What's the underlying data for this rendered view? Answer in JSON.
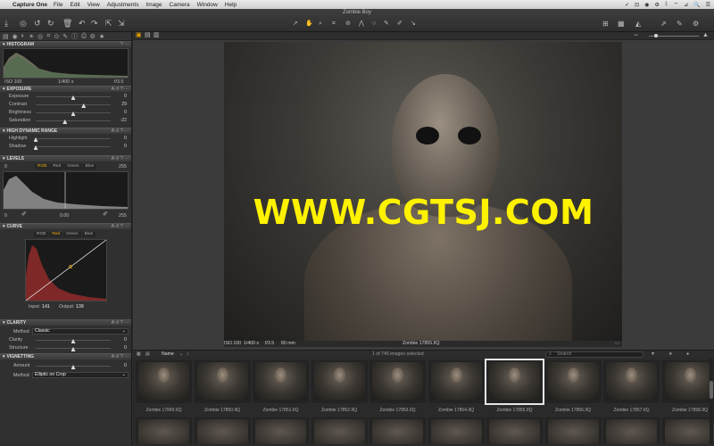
{
  "menubar": {
    "apple": "",
    "app": "Capture One",
    "items": [
      "File",
      "Edit",
      "View",
      "Adjustments",
      "Image",
      "Camera",
      "Window",
      "Help"
    ],
    "status": [
      "✓",
      "⊡",
      "◉",
      "⚙",
      "ᛒ",
      "⌔",
      "⊿",
      "🔍",
      "☰"
    ]
  },
  "window": {
    "title": "Zombie Boy"
  },
  "histogram": {
    "title": "HISTOGRAM",
    "iso": "ISO 100",
    "shutter": "1/400 s",
    "aperture": "f/3.5"
  },
  "exposure": {
    "title": "EXPOSURE",
    "sliders": [
      {
        "label": "Exposure",
        "value": "0",
        "level": 0.5
      },
      {
        "label": "Contrast",
        "value": "29",
        "level": 0.64
      },
      {
        "label": "Brightness",
        "value": "0",
        "level": 0.5
      },
      {
        "label": "Saturation",
        "value": "-22",
        "level": 0.39
      }
    ]
  },
  "hdr": {
    "title": "HIGH DYNAMIC RANGE",
    "sliders": [
      {
        "label": "Highlight",
        "value": "0",
        "level": 0.0
      },
      {
        "label": "Shadow",
        "value": "0",
        "level": 0.0
      }
    ]
  },
  "levels": {
    "title": "LEVELS",
    "left": "0",
    "right": "255",
    "tabs": [
      "RGB",
      "Red",
      "Green",
      "Blue"
    ],
    "active_tab": "RGB",
    "bottom_left": "0",
    "mid": "0.00",
    "bottom_right": "255"
  },
  "curve": {
    "title": "CURVE",
    "tabs": [
      "RGB",
      "Red",
      "Green",
      "Blue"
    ],
    "active_tab": "Red",
    "input_label": "Input:",
    "input_value": "141",
    "output_label": "Output:",
    "output_value": "139"
  },
  "clarity": {
    "title": "CLARITY",
    "method_label": "Method",
    "method_value": "Classic",
    "sliders": [
      {
        "label": "Clarity",
        "value": "0",
        "level": 0.5
      },
      {
        "label": "Structure",
        "value": "0",
        "level": 0.5
      }
    ]
  },
  "vignetting": {
    "title": "VIGNETTING",
    "amount_label": "Amount",
    "amount_value": "0",
    "amount_level": 0.5,
    "method_label": "Method",
    "method_value": "Elliptic on Crop"
  },
  "viewer": {
    "watermark": "WWW.CGTSJ.COM",
    "info_iso": "ISO 100",
    "info_shutter": "1/400 s",
    "info_aperture": "f/3.5",
    "info_focal": "80 mm",
    "info_filename": "Zombie 17855.IIQ"
  },
  "browser": {
    "sort_label": "Name",
    "selection_text": "1 of 745 images selected",
    "search_placeholder": "Search",
    "thumbnails": [
      "Zombie 17849.IIQ",
      "Zombie 17850.IIQ",
      "Zombie 17851.IIQ",
      "Zombie 17852.IIQ",
      "Zombie 17853.IIQ",
      "Zombie 17854.IIQ",
      "Zombie 17855.IIQ",
      "Zombie 17856.IIQ",
      "Zombie 17857.IIQ",
      "Zombie 17858.IIQ"
    ],
    "selected_index": 6
  },
  "icons": {
    "tool_tabs": [
      "import-icon",
      "camera-icon",
      "library-icon",
      "exposure-icon",
      "color-icon",
      "crop-icon",
      "lens-icon",
      "details-icon",
      "metadata-icon",
      "output-icon",
      "settings-icon",
      "batch-icon"
    ],
    "toolbar_left": [
      "import-icon",
      "capture-icon",
      "history-icon",
      "redo-icon",
      "trash-icon",
      "undo-icon",
      "redo-icon",
      "copy-icon"
    ],
    "toolbar_center": [
      "cursor-icon",
      "pan-icon",
      "zoom-icon",
      "crop-icon",
      "straighten-icon",
      "keystone-icon",
      "spot-icon",
      "mask-icon",
      "draw-icon",
      "picker-icon",
      "apply-icon"
    ],
    "toolbar_right": [
      "grid-icon",
      "proof-icon",
      "exposure-warning-icon",
      "focus-icon",
      "share-icon",
      "settings-icon"
    ]
  }
}
